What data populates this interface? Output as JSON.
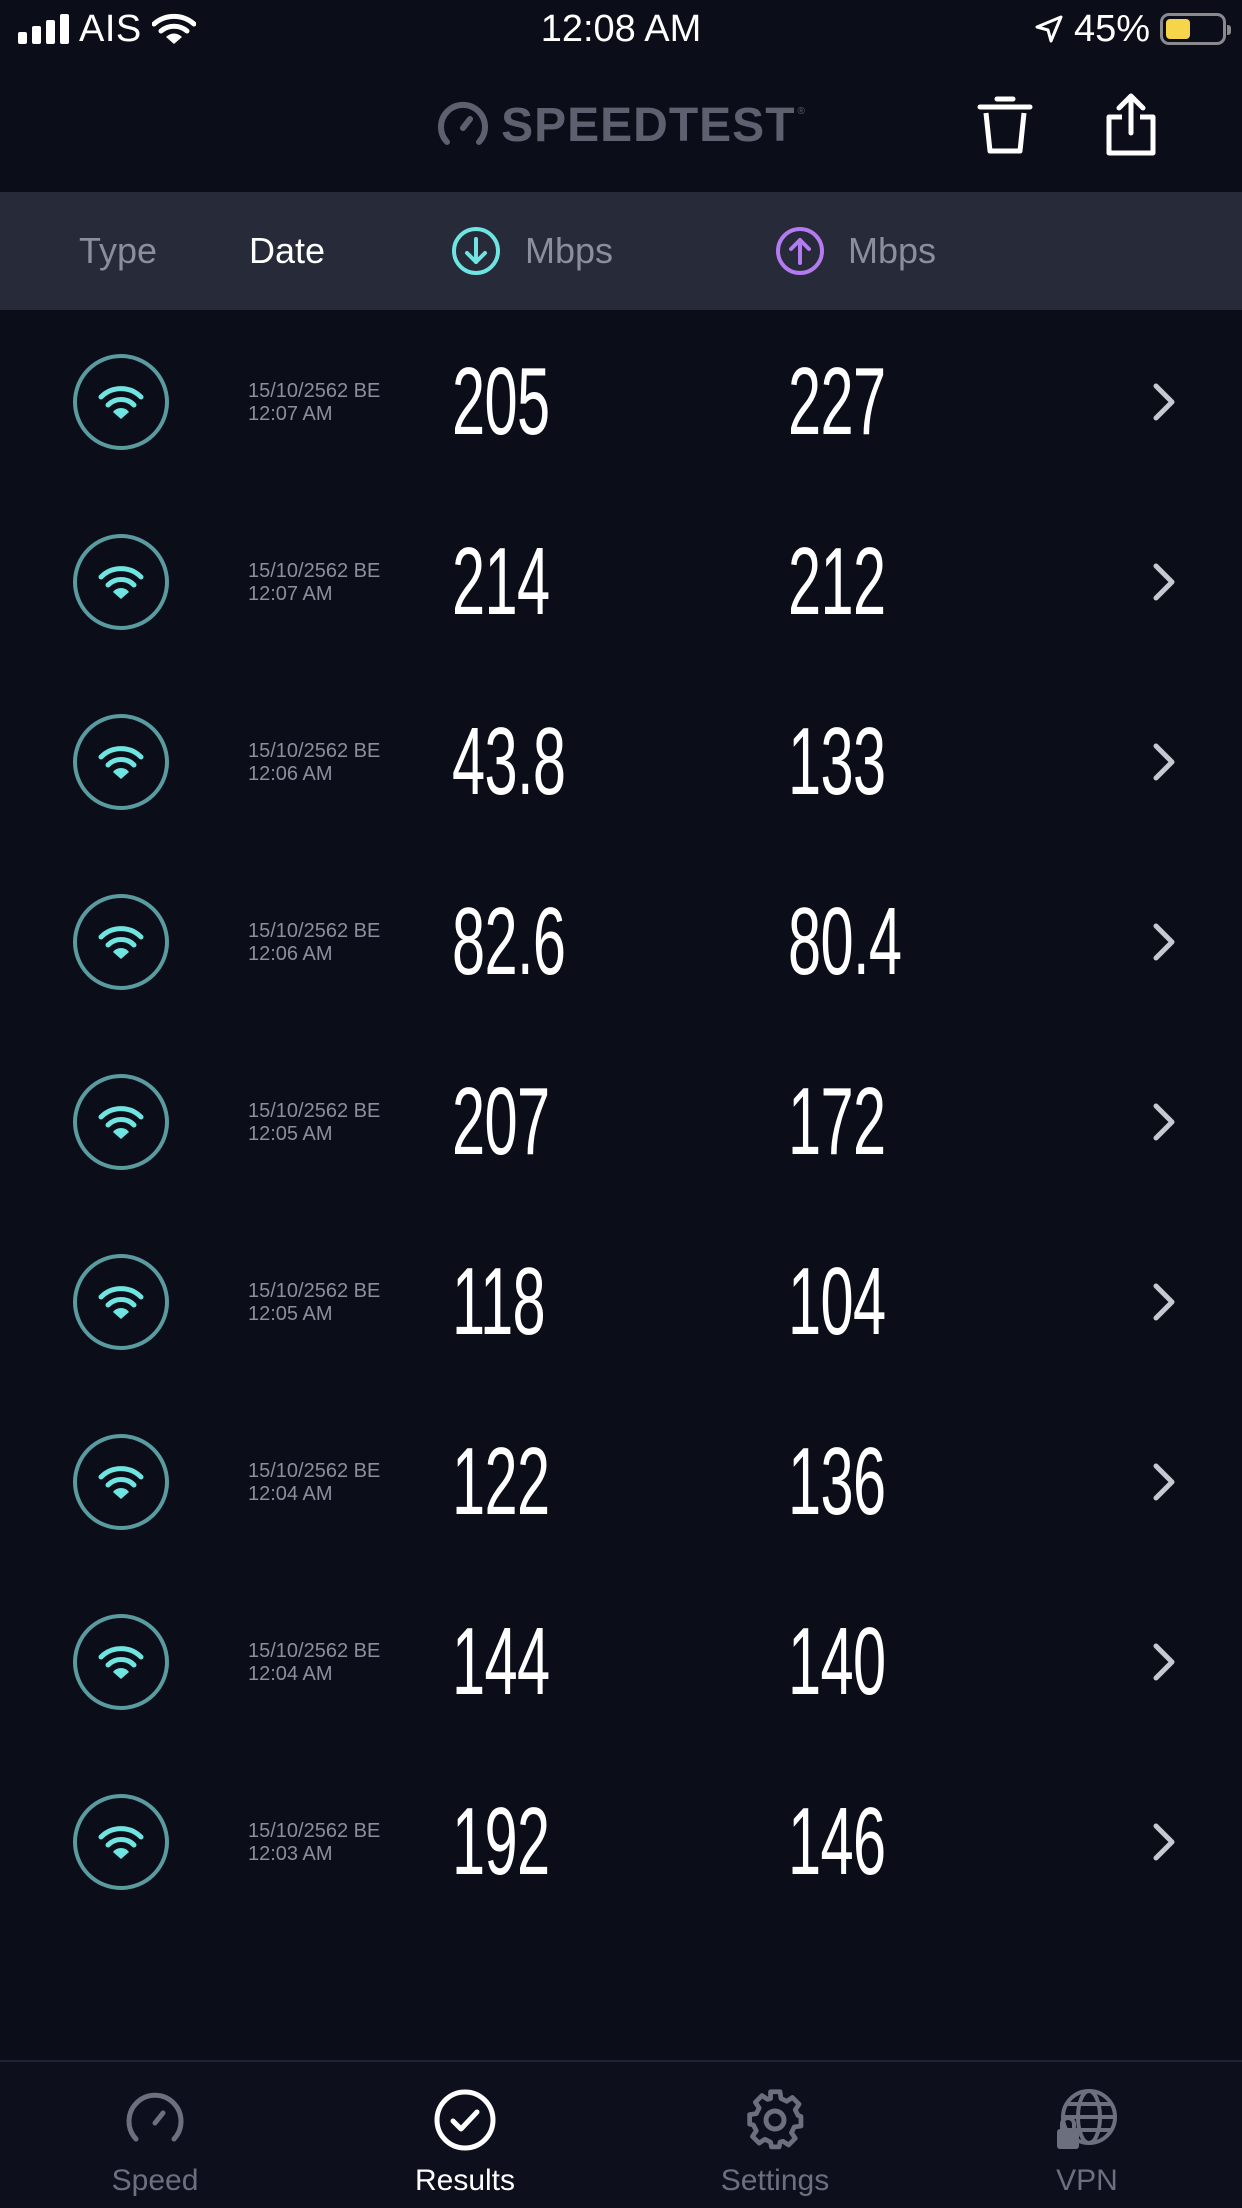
{
  "status_bar": {
    "carrier": "AIS",
    "time": "12:08 AM",
    "battery_percent": "45%",
    "battery_level": 0.45,
    "battery_color": "#f7d54a"
  },
  "header": {
    "logo_text": "SPEEDTEST",
    "logo_mark": "®",
    "actions": [
      "trash-icon",
      "share-icon"
    ]
  },
  "columns": {
    "type": "Type",
    "date": "Date",
    "download_unit": "Mbps",
    "upload_unit": "Mbps",
    "download_color": "#6fe4e0",
    "upload_color": "#b47af0"
  },
  "results": [
    {
      "date": "15/10/2562 BE",
      "time": "12:07 AM",
      "download": "205",
      "upload": "227",
      "type_icon": "wifi-icon"
    },
    {
      "date": "15/10/2562 BE",
      "time": "12:07 AM",
      "download": "214",
      "upload": "212",
      "type_icon": "wifi-icon"
    },
    {
      "date": "15/10/2562 BE",
      "time": "12:06 AM",
      "download": "43.8",
      "upload": "133",
      "type_icon": "wifi-icon"
    },
    {
      "date": "15/10/2562 BE",
      "time": "12:06 AM",
      "download": "82.6",
      "upload": "80.4",
      "type_icon": "wifi-icon"
    },
    {
      "date": "15/10/2562 BE",
      "time": "12:05 AM",
      "download": "207",
      "upload": "172",
      "type_icon": "wifi-icon"
    },
    {
      "date": "15/10/2562 BE",
      "time": "12:05 AM",
      "download": "118",
      "upload": "104",
      "type_icon": "wifi-icon"
    },
    {
      "date": "15/10/2562 BE",
      "time": "12:04 AM",
      "download": "122",
      "upload": "136",
      "type_icon": "wifi-icon"
    },
    {
      "date": "15/10/2562 BE",
      "time": "12:04 AM",
      "download": "144",
      "upload": "140",
      "type_icon": "wifi-icon"
    },
    {
      "date": "15/10/2562 BE",
      "time": "12:03 AM",
      "download": "192",
      "upload": "146",
      "type_icon": "wifi-icon"
    }
  ],
  "tabs": [
    {
      "label": "Speed",
      "icon": "gauge-icon",
      "active": false
    },
    {
      "label": "Results",
      "icon": "checkmark-circle-icon",
      "active": true
    },
    {
      "label": "Settings",
      "icon": "gear-icon",
      "active": false
    },
    {
      "label": "VPN",
      "icon": "globe-lock-icon",
      "active": false
    }
  ]
}
